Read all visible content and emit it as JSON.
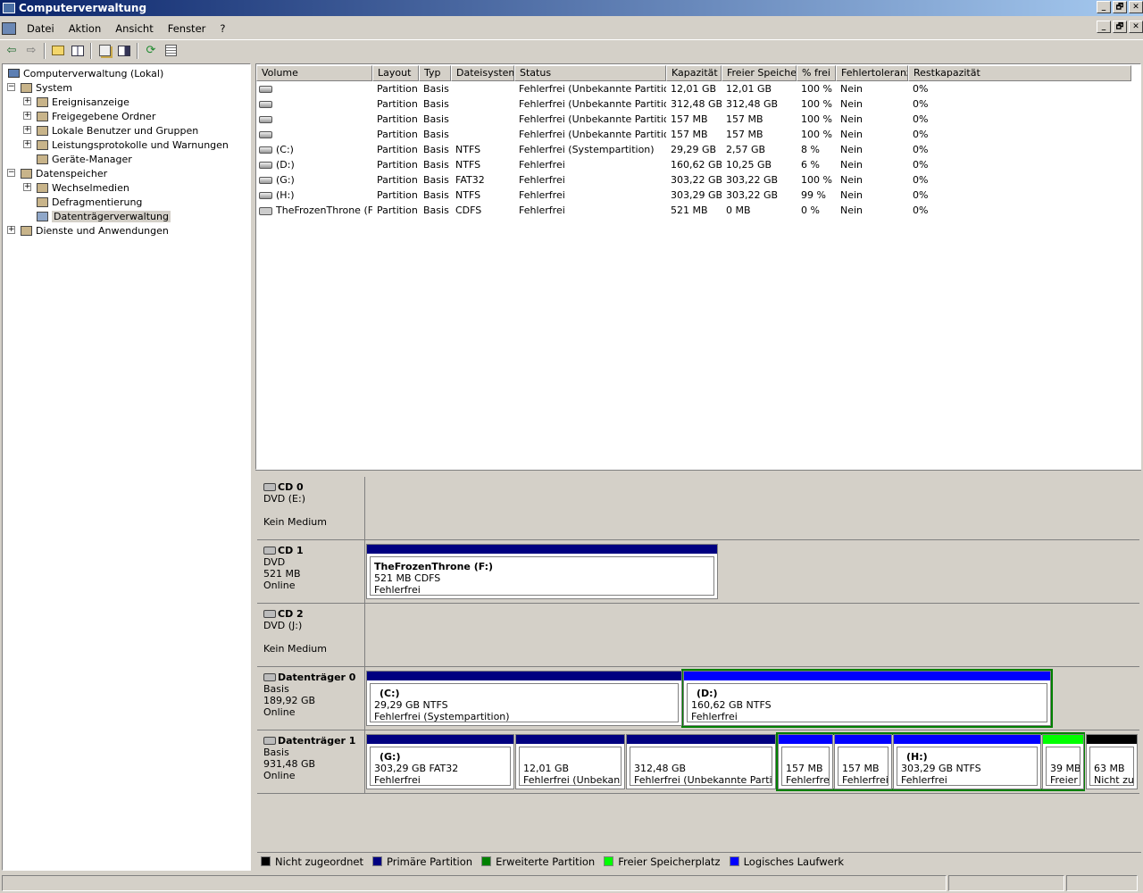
{
  "window": {
    "title": "Computerverwaltung",
    "controls": [
      "_",
      "🗗",
      "✕"
    ]
  },
  "menu": [
    "Datei",
    "Aktion",
    "Ansicht",
    "Fenster",
    "?"
  ],
  "toolbar": {
    "buttons": [
      "back-icon",
      "forward-icon",
      "up-icon",
      "show-hide-tree-icon",
      "properties-icon",
      "help-icon",
      "refresh-icon",
      "export-icon"
    ]
  },
  "tree": {
    "root": "Computerverwaltung (Lokal)",
    "nodes": [
      {
        "label": "System",
        "level": 1,
        "exp": "−"
      },
      {
        "label": "Ereignisanzeige",
        "level": 2,
        "exp": "+"
      },
      {
        "label": "Freigegebene Ordner",
        "level": 2,
        "exp": "+"
      },
      {
        "label": "Lokale Benutzer und Gruppen",
        "level": 2,
        "exp": "+"
      },
      {
        "label": "Leistungsprotokolle und Warnungen",
        "level": 2,
        "exp": "+"
      },
      {
        "label": "Geräte-Manager",
        "level": 2,
        "exp": ""
      },
      {
        "label": "Datenspeicher",
        "level": 1,
        "exp": "−"
      },
      {
        "label": "Wechselmedien",
        "level": 2,
        "exp": "+"
      },
      {
        "label": "Defragmentierung",
        "level": 2,
        "exp": ""
      },
      {
        "label": "Datenträgerverwaltung",
        "level": 2,
        "exp": "",
        "selected": true
      },
      {
        "label": "Dienste und Anwendungen",
        "level": 1,
        "exp": "+"
      }
    ]
  },
  "volumes": {
    "columns": [
      "Volume",
      "Layout",
      "Typ",
      "Dateisystem",
      "Status",
      "Kapazität",
      "Freier Speicher",
      "% frei",
      "Fehlertoleranz",
      "Restkapazität"
    ],
    "rows": [
      {
        "volume": "",
        "layout": "Partition",
        "typ": "Basis",
        "fs": "",
        "status": "Fehlerfrei (Unbekannte Partition)",
        "cap": "12,01 GB",
        "free": "12,01 GB",
        "pct": "100 %",
        "ft": "Nein",
        "rest": "0%",
        "icon": "drive"
      },
      {
        "volume": "",
        "layout": "Partition",
        "typ": "Basis",
        "fs": "",
        "status": "Fehlerfrei (Unbekannte Partition)",
        "cap": "312,48 GB",
        "free": "312,48 GB",
        "pct": "100 %",
        "ft": "Nein",
        "rest": "0%",
        "icon": "drive"
      },
      {
        "volume": "",
        "layout": "Partition",
        "typ": "Basis",
        "fs": "",
        "status": "Fehlerfrei (Unbekannte Partition)",
        "cap": "157 MB",
        "free": "157 MB",
        "pct": "100 %",
        "ft": "Nein",
        "rest": "0%",
        "icon": "drive"
      },
      {
        "volume": "",
        "layout": "Partition",
        "typ": "Basis",
        "fs": "",
        "status": "Fehlerfrei (Unbekannte Partition)",
        "cap": "157 MB",
        "free": "157 MB",
        "pct": "100 %",
        "ft": "Nein",
        "rest": "0%",
        "icon": "drive"
      },
      {
        "volume": "(C:)",
        "layout": "Partition",
        "typ": "Basis",
        "fs": "NTFS",
        "status": "Fehlerfrei (Systempartition)",
        "cap": "29,29 GB",
        "free": "2,57 GB",
        "pct": "8 %",
        "ft": "Nein",
        "rest": "0%",
        "icon": "drive"
      },
      {
        "volume": "(D:)",
        "layout": "Partition",
        "typ": "Basis",
        "fs": "NTFS",
        "status": "Fehlerfrei",
        "cap": "160,62 GB",
        "free": "10,25 GB",
        "pct": "6 %",
        "ft": "Nein",
        "rest": "0%",
        "icon": "drive"
      },
      {
        "volume": "(G:)",
        "layout": "Partition",
        "typ": "Basis",
        "fs": "FAT32",
        "status": "Fehlerfrei",
        "cap": "303,22 GB",
        "free": "303,22 GB",
        "pct": "100 %",
        "ft": "Nein",
        "rest": "0%",
        "icon": "drive"
      },
      {
        "volume": "(H:)",
        "layout": "Partition",
        "typ": "Basis",
        "fs": "NTFS",
        "status": "Fehlerfrei",
        "cap": "303,29 GB",
        "free": "303,22 GB",
        "pct": "99 %",
        "ft": "Nein",
        "rest": "0%",
        "icon": "drive"
      },
      {
        "volume": "TheFrozenThrone (F:)",
        "layout": "Partition",
        "typ": "Basis",
        "fs": "CDFS",
        "status": "Fehlerfrei",
        "cap": "521 MB",
        "free": "0 MB",
        "pct": "0 %",
        "ft": "Nein",
        "rest": "0%",
        "icon": "cd"
      }
    ]
  },
  "disks": [
    {
      "name": "CD 0",
      "lines": [
        "DVD (E:)",
        "",
        "Kein Medium"
      ],
      "icon": "cd",
      "partitions": []
    },
    {
      "name": "CD 1",
      "lines": [
        "DVD",
        "521 MB",
        "Online"
      ],
      "icon": "cd",
      "partitions": [
        {
          "title": "TheFrozenThrone  (F:)",
          "l1": "521 MB CDFS",
          "l2": "Fehlerfrei",
          "kind": "primary"
        }
      ]
    },
    {
      "name": "CD 2",
      "lines": [
        "DVD (J:)",
        "",
        "Kein Medium"
      ],
      "icon": "cd",
      "partitions": []
    },
    {
      "name": "Datenträger 0",
      "lines": [
        "Basis",
        "189,92 GB",
        "Online"
      ],
      "icon": "disk",
      "partitions": [
        {
          "title": "(C:)",
          "l1": "29,29 GB NTFS",
          "l2": "Fehlerfrei (Systempartition)",
          "kind": "primary"
        },
        {
          "title": "(D:)",
          "l1": "160,62 GB NTFS",
          "l2": "Fehlerfrei",
          "kind": "logical"
        }
      ]
    },
    {
      "name": "Datenträger 1",
      "lines": [
        "Basis",
        "931,48 GB",
        "Online"
      ],
      "icon": "disk",
      "partitions": [
        {
          "title": "(G:)",
          "l1": "303,29 GB FAT32",
          "l2": "Fehlerfrei",
          "kind": "primary"
        },
        {
          "title": "",
          "l1": "12,01 GB",
          "l2": "Fehlerfrei (Unbekannte",
          "kind": "primary"
        },
        {
          "title": "",
          "l1": "312,48 GB",
          "l2": "Fehlerfrei (Unbekannte Partition",
          "kind": "primary"
        },
        {
          "title": "",
          "l1": "157 MB",
          "l2": "Fehlerfrei",
          "kind": "logical"
        },
        {
          "title": "",
          "l1": "157 MB",
          "l2": "Fehlerfrei (",
          "kind": "logical"
        },
        {
          "title": "(H:)",
          "l1": "303,29 GB NTFS",
          "l2": "Fehlerfrei",
          "kind": "logical"
        },
        {
          "title": "",
          "l1": "39 MB",
          "l2": "Freier",
          "kind": "free"
        },
        {
          "title": "",
          "l1": "63 MB",
          "l2": "Nicht zug",
          "kind": "unalloc"
        }
      ]
    }
  ],
  "legend": [
    {
      "label": "Nicht zugeordnet",
      "color": "#000000"
    },
    {
      "label": "Primäre Partition",
      "color": "#000080"
    },
    {
      "label": "Erweiterte Partition",
      "color": "#008000"
    },
    {
      "label": "Freier Speicherplatz",
      "color": "#00ff00"
    },
    {
      "label": "Logisches Laufwerk",
      "color": "#0000ff"
    }
  ],
  "colors": {
    "primary": "#000080",
    "logical": "#0000ff",
    "extended": "#008000",
    "free": "#00ff00",
    "unalloc": "#000000"
  }
}
